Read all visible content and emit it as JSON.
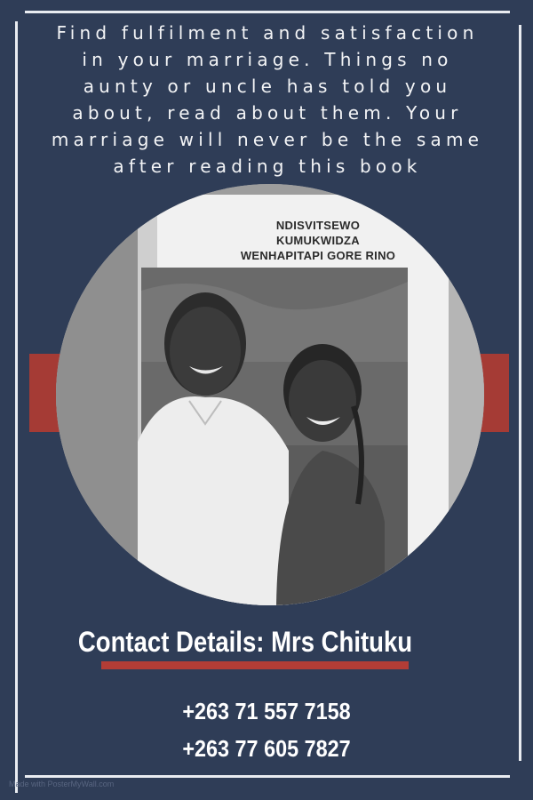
{
  "headline_lines": [
    "Find fulfilment and satisfaction",
    "in your marriage. Things no",
    "aunty or uncle has told you",
    "about, read about them. Your",
    "marriage will never be the same",
    "after reading this book"
  ],
  "book_cover_lines": [
    "NDISVITSEWO",
    "KUMUKWIDZA",
    "WENHAPITAPI GORE RINO"
  ],
  "contact": {
    "heading": "Contact Details: Mrs Chituku",
    "phones": [
      "+263 71 557 7158",
      "+263 77 605 7827"
    ]
  },
  "watermark": "Made with PosterMyWall.com",
  "colors": {
    "background": "#2f3d57",
    "accent_red": "#a53b35",
    "frame": "#e9ecf1"
  }
}
